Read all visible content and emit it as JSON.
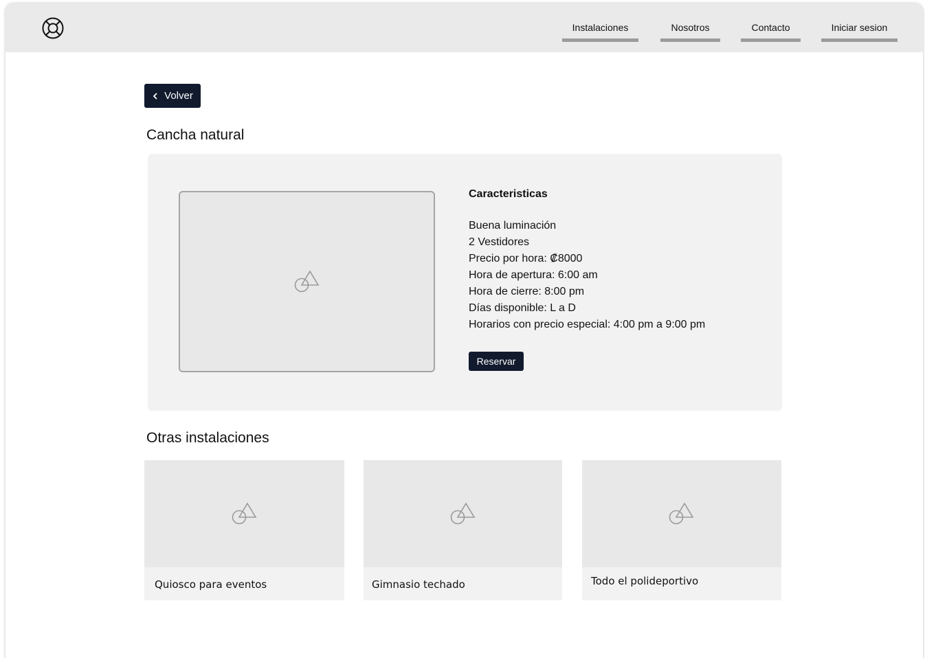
{
  "header": {
    "logo_icon": "lifebuoy-icon",
    "nav": [
      {
        "label": "Instalaciones"
      },
      {
        "label": "Nosotros"
      },
      {
        "label": "Contacto"
      },
      {
        "label": "Iniciar sesion"
      }
    ]
  },
  "back_button": {
    "label": "Volver",
    "icon": "chevron-left-icon"
  },
  "facility": {
    "title": "Cancha natural",
    "image_icon": "image-placeholder-icon",
    "features_title": "Caracteristicas",
    "features": [
      "Buena luminación",
      "2 Vestidores",
      "Precio por hora: ₡8000",
      "Hora de apertura: 6:00 am",
      "Hora de cierre: 8:00 pm",
      "Días disponible: L a D",
      "Horarios con precio especial: 4:00 pm a 9:00 pm"
    ],
    "reserve_label": "Reservar"
  },
  "others": {
    "title": "Otras instalaciones",
    "cards": [
      {
        "caption": "Quiosco para eventos"
      },
      {
        "caption": "Gimnasio techado"
      },
      {
        "caption": "Todo el polideportivo"
      }
    ]
  },
  "colors": {
    "dark_button": "#121a2e",
    "header_bg": "#eaeaea",
    "card_bg": "#f2f2f2",
    "placeholder_bg": "#e8e8e8",
    "nav_underline": "#9b9b9b"
  }
}
